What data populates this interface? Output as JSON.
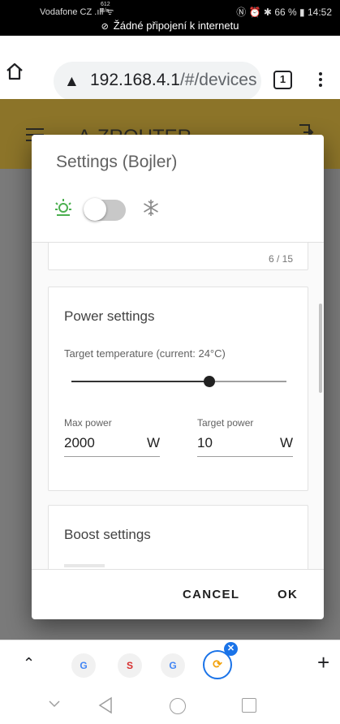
{
  "statusbar": {
    "carrier": "Vodafone CZ",
    "net_speed_value": "612",
    "net_speed_unit": "B/s",
    "battery": "66 %",
    "time": "14:52",
    "offline_message": "Žádné připojení k internetu"
  },
  "browser": {
    "url_host": "192.168.4.1",
    "url_path": "/#/devices",
    "tab_count": "1"
  },
  "app": {
    "brand": "A-ZROUTER"
  },
  "dialog": {
    "title": "Settings (Bojler)",
    "toggle_state": "off",
    "prev_card_counter": "6 / 15",
    "power": {
      "title": "Power settings",
      "target_label": "Target temperature (current: 24°C)",
      "slider_fraction": 0.64,
      "max_power_label": "Max power",
      "max_power_value": "2000",
      "max_power_unit": "W",
      "target_power_label": "Target power",
      "target_power_value": "10",
      "target_power_unit": "W"
    },
    "boost": {
      "title": "Boost settings"
    },
    "cancel_label": "CANCEL",
    "ok_label": "OK"
  },
  "tabstrip": {
    "favicons": [
      "G",
      "S",
      "G"
    ]
  },
  "colors": {
    "app_bar_dimmed": "#8c7429",
    "accent_blue": "#1a73e8",
    "sun_icon_green": "#4caf50"
  }
}
